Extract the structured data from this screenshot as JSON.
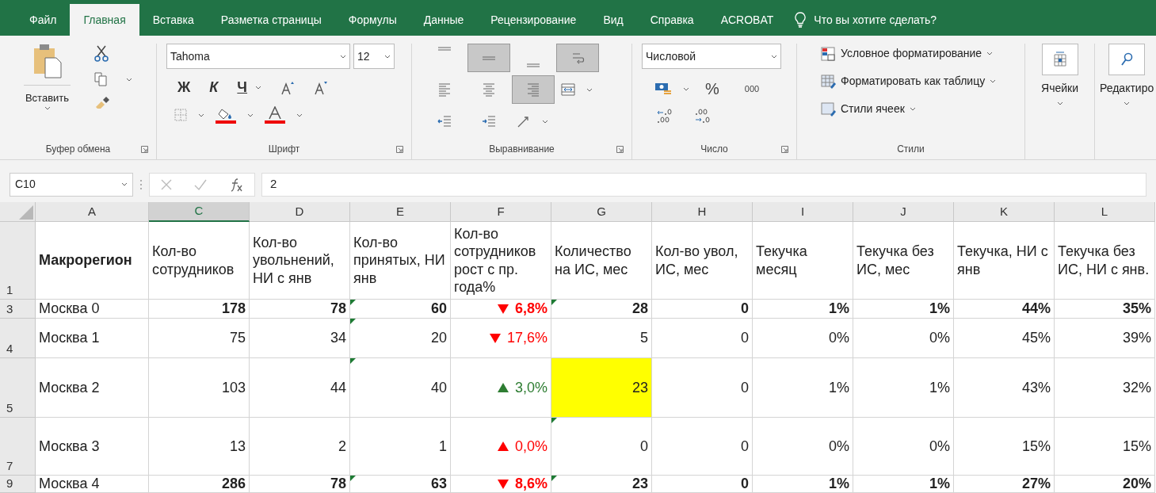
{
  "tabs": [
    {
      "label": "Файл",
      "selected": false
    },
    {
      "label": "Главная",
      "selected": true
    },
    {
      "label": "Вставка",
      "selected": false
    },
    {
      "label": "Разметка страницы",
      "selected": false
    },
    {
      "label": "Формулы",
      "selected": false
    },
    {
      "label": "Данные",
      "selected": false
    },
    {
      "label": "Рецензирование",
      "selected": false
    },
    {
      "label": "Вид",
      "selected": false
    },
    {
      "label": "Справка",
      "selected": false
    },
    {
      "label": "ACROBAT",
      "selected": false
    }
  ],
  "tell_me": {
    "placeholder": "Что вы хотите сделать?"
  },
  "ribbon": {
    "clipboard": {
      "paste_label": "Вставить",
      "group_label": "Буфер обмена"
    },
    "font": {
      "font_name": "Tahoma",
      "font_size": "12",
      "bold": "Ж",
      "italic": "К",
      "underline": "Ч",
      "group_label": "Шрифт"
    },
    "alignment": {
      "buttons": [
        {
          "kind": "top",
          "pressed": false
        },
        {
          "kind": "middle",
          "pressed": true
        },
        {
          "kind": "bottom",
          "pressed": false
        },
        {
          "kind": "wrap",
          "pressed": true
        },
        {
          "kind": "left",
          "pressed": false
        },
        {
          "kind": "center",
          "pressed": false
        },
        {
          "kind": "right",
          "pressed": true
        },
        {
          "kind": "merge",
          "pressed": false
        },
        {
          "kind": "outdent",
          "pressed": false
        },
        {
          "kind": "indent",
          "pressed": false
        },
        {
          "kind": "orientation",
          "pressed": false
        }
      ],
      "group_label": "Выравнивание"
    },
    "number": {
      "format": "Числовой",
      "percent": "%",
      "thousands": "000",
      "group_label": "Число"
    },
    "styles": {
      "items": [
        "Условное форматирование",
        "Форматировать как таблицу",
        "Стили ячеек"
      ],
      "group_label": "Стили"
    },
    "cells": {
      "label": "Ячейки"
    },
    "editing": {
      "label": "Редактиро"
    }
  },
  "formula_bar": {
    "name_box": "C10",
    "value": "2"
  },
  "columns": [
    {
      "letter": "A",
      "selected": false
    },
    {
      "letter": "C",
      "selected": true
    },
    {
      "letter": "D",
      "selected": false
    },
    {
      "letter": "E",
      "selected": false
    },
    {
      "letter": "F",
      "selected": false
    },
    {
      "letter": "G",
      "selected": false
    },
    {
      "letter": "H",
      "selected": false
    },
    {
      "letter": "I",
      "selected": false
    },
    {
      "letter": "J",
      "selected": false
    },
    {
      "letter": "K",
      "selected": false
    },
    {
      "letter": "L",
      "selected": false
    }
  ],
  "header_row": {
    "number": "1",
    "cells": [
      "Макрорегион",
      "Кол-во сотрудников",
      "Кол-во увольнений, НИ с янв",
      "Кол-во принятых, НИ янв",
      "Кол-во сотрудников рост с пр. года%",
      "Количество на ИС, мес",
      "Кол-во увол, ИС, мес",
      "Текучка месяц",
      "Текучка без ИС, мес",
      "Текучка, НИ с янв",
      "Текучка без ИС, НИ с янв."
    ]
  },
  "rows": [
    {
      "number": "3",
      "bold": true,
      "region": "Москва 0",
      "falling": true,
      "color": "#ff0000",
      "highlight": false,
      "cells": [
        {
          "text": "178",
          "flag": false
        },
        {
          "text": "78",
          "flag": false
        },
        {
          "text": "60",
          "flag": true
        },
        {
          "text": "6,8%",
          "flag": false
        },
        {
          "text": "28",
          "flag": true
        },
        {
          "text": "0",
          "flag": false
        },
        {
          "text": "1%",
          "flag": false
        },
        {
          "text": "1%",
          "flag": false
        },
        {
          "text": "44%",
          "flag": false
        },
        {
          "text": "35%",
          "flag": false
        }
      ]
    },
    {
      "number": "4",
      "bold": false,
      "region": "Москва 1",
      "falling": true,
      "color": "#ff0000",
      "highlight": false,
      "cells": [
        {
          "text": "75",
          "flag": false
        },
        {
          "text": "34",
          "flag": false
        },
        {
          "text": "20",
          "flag": true
        },
        {
          "text": "17,6%",
          "flag": false
        },
        {
          "text": "5",
          "flag": false
        },
        {
          "text": "0",
          "flag": false
        },
        {
          "text": "0%",
          "flag": false
        },
        {
          "text": "0%",
          "flag": false
        },
        {
          "text": "45%",
          "flag": false
        },
        {
          "text": "39%",
          "flag": false
        }
      ]
    },
    {
      "number": "5",
      "bold": false,
      "region": "Москва 2",
      "falling": false,
      "color": "#2e7d32",
      "highlight": true,
      "cells": [
        {
          "text": "103",
          "flag": false
        },
        {
          "text": "44",
          "flag": false
        },
        {
          "text": "40",
          "flag": true
        },
        {
          "text": "3,0%",
          "flag": false
        },
        {
          "text": "23",
          "flag": false
        },
        {
          "text": "0",
          "flag": false
        },
        {
          "text": "1%",
          "flag": false
        },
        {
          "text": "1%",
          "flag": false
        },
        {
          "text": "43%",
          "flag": false
        },
        {
          "text": "32%",
          "flag": false
        }
      ]
    },
    {
      "number": "7",
      "bold": false,
      "region": "Москва 3",
      "falling": false,
      "color": "#ff0000",
      "highlight": false,
      "cells": [
        {
          "text": "13",
          "flag": false
        },
        {
          "text": "2",
          "flag": false
        },
        {
          "text": "1",
          "flag": false
        },
        {
          "text": "0,0%",
          "flag": false
        },
        {
          "text": "0",
          "flag": true
        },
        {
          "text": "0",
          "flag": false
        },
        {
          "text": "0%",
          "flag": false
        },
        {
          "text": "0%",
          "flag": false
        },
        {
          "text": "15%",
          "flag": false
        },
        {
          "text": "15%",
          "flag": false
        }
      ]
    },
    {
      "number": "9",
      "bold": true,
      "region": "Москва 4",
      "falling": true,
      "color": "#ff0000",
      "highlight": false,
      "cells": [
        {
          "text": "286",
          "flag": false
        },
        {
          "text": "78",
          "flag": false
        },
        {
          "text": "63",
          "flag": true
        },
        {
          "text": "8,6%",
          "flag": false
        },
        {
          "text": "23",
          "flag": true
        },
        {
          "text": "0",
          "flag": false
        },
        {
          "text": "1%",
          "flag": false
        },
        {
          "text": "1%",
          "flag": false
        },
        {
          "text": "27%",
          "flag": false
        },
        {
          "text": "20%",
          "flag": false
        }
      ]
    }
  ]
}
